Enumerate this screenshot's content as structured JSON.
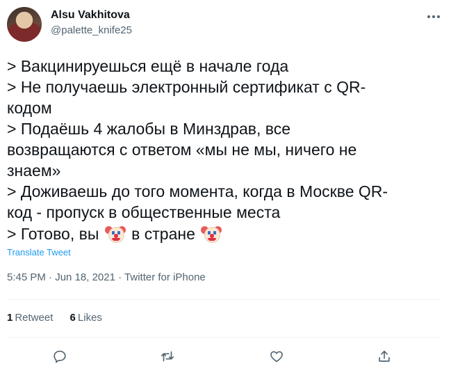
{
  "author": {
    "display_name": "Alsu Vakhitova",
    "handle": "@palette_knife25"
  },
  "tweet": {
    "lines": [
      "> Вакцинируешься ещё в начале года",
      "> Не получаешь электронный сертификат с QR-",
      "кодом",
      "> Подаёшь 4 жалобы в Минздрав, все",
      "возвращаются с ответом «мы не мы, ничего не",
      "знаем»",
      "> Доживаешь до того момента, когда в Москве QR-",
      "код - пропуск в общественные места"
    ],
    "last_line": {
      "part1": "> Готово, вы",
      "part2": "в стране",
      "emoji": "clown-face"
    }
  },
  "translate_label": "Translate Tweet",
  "meta": {
    "time": "5:45 PM",
    "separator": "·",
    "date": "Jun 18, 2021",
    "source": "Twitter for iPhone"
  },
  "stats": {
    "retweets_count": "1",
    "retweets_label": "Retweet",
    "likes_count": "6",
    "likes_label": "Likes"
  },
  "actions": [
    "reply-icon",
    "retweet-icon",
    "like-icon",
    "share-icon"
  ],
  "colors": {
    "link": "#1d9bf0",
    "secondary_text": "#536471",
    "primary_text": "#0f1419"
  }
}
